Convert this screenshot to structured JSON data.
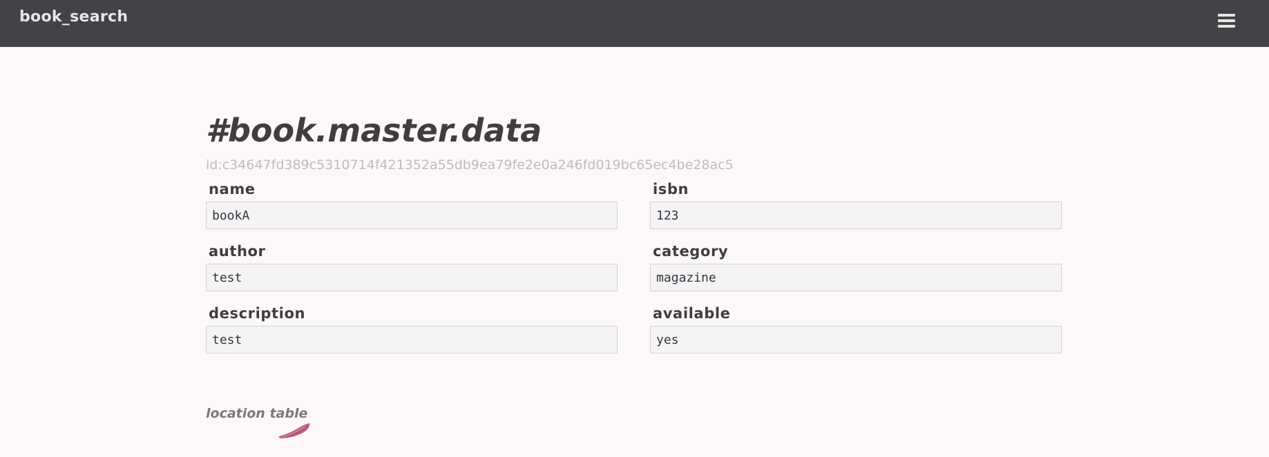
{
  "app": {
    "title": "book_search"
  },
  "header": {
    "menu_icon": "hamburger-menu-icon"
  },
  "page": {
    "title": "#book.master.data",
    "record_id": "id:c34647fd389c5310714f421352a55db9ea79fe2e0a246fd019bc65ec4be28ac5"
  },
  "fields": [
    {
      "label": "name",
      "value": "bookA"
    },
    {
      "label": "isbn",
      "value": "123"
    },
    {
      "label": "author",
      "value": "test"
    },
    {
      "label": "category",
      "value": "magazine"
    },
    {
      "label": "description",
      "value": "test"
    },
    {
      "label": "available",
      "value": "yes"
    }
  ],
  "location": {
    "link_label": "location table"
  },
  "colors": {
    "navbar_bg": "#434247",
    "page_bg": "#fcf8f7",
    "input_bg": "#f4f4f4",
    "brush_accent": "#b5456a"
  }
}
